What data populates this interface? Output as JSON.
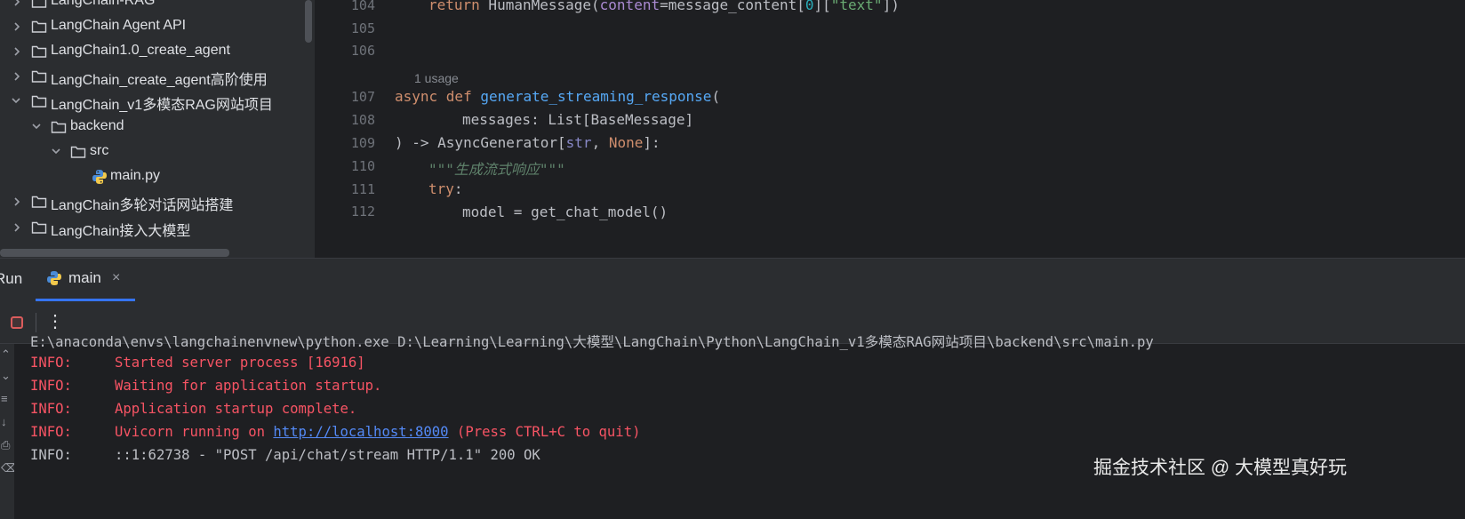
{
  "project_tree": {
    "items": [
      {
        "label": "LangChain-RAG",
        "expanded": false
      },
      {
        "label": "LangChain Agent API",
        "expanded": false
      },
      {
        "label": "LangChain1.0_create_agent",
        "expanded": false
      },
      {
        "label": "LangChain_create_agent高阶使用",
        "expanded": false
      },
      {
        "label": "LangChain_v1多模态RAG网站项目",
        "expanded": true
      },
      {
        "label": "backend",
        "expanded": true
      },
      {
        "label": "src",
        "expanded": true
      },
      {
        "label": "main.py",
        "type": "python-file"
      },
      {
        "label": "LangChain多轮对话网站搭建",
        "expanded": false
      },
      {
        "label": "LangChain接入大模型",
        "expanded": false
      }
    ]
  },
  "editor": {
    "line_numbers": [
      "104",
      "105",
      "106",
      "107",
      "108",
      "109",
      "110",
      "111",
      "112"
    ],
    "usage_hint": "1 usage",
    "code": {
      "l104": {
        "kw": "return",
        "call": " HumanMessage(",
        "param": "content",
        "eq": "=message_content[",
        "idx": "0",
        "mid": "][",
        "str": "\"text\"",
        "end": "])"
      },
      "l107": {
        "kw": "async def",
        "fn": "generate_streaming_response",
        "end": "("
      },
      "l108": {
        "text": "messages: List[BaseMessage]"
      },
      "l109": {
        "a": ") -> AsyncGenerator[",
        "builtin": "str",
        "comma": ", ",
        "none": "None",
        "end": "]:"
      },
      "l110": {
        "doc": "\"\"\"生成流式响应\"\"\""
      },
      "l111": {
        "kw": "try",
        "end": ":"
      },
      "l112": {
        "text": "model = get_chat_model()"
      }
    }
  },
  "run_window": {
    "title": "Run",
    "tab_label": "main",
    "close_symbol": "×",
    "more_symbol": "⋮"
  },
  "console": {
    "command": "E:\\anaconda\\envs\\langchainenvnew\\python.exe D:\\Learning\\Learning\\大模型\\LangChain\\Python\\LangChain_v1多模态RAG网站项目\\backend\\src\\main.py",
    "lines": [
      {
        "level": "INFO:",
        "message": "Started server process [16916]"
      },
      {
        "level": "INFO:",
        "message": "Waiting for application startup."
      },
      {
        "level": "INFO:",
        "message": "Application startup complete."
      }
    ],
    "uvicorn": {
      "level": "INFO:",
      "prefix": "Uvicorn running on ",
      "link": "http://localhost:8000",
      "suffix": " (Press CTRL+C to quit)"
    },
    "request": {
      "level": "INFO:",
      "message": "::1:62738 - \"POST /api/chat/stream HTTP/1.1\" 200 OK"
    }
  },
  "watermark": "掘金技术社区 @ 大模型真好玩",
  "colors": {
    "accent": "#3574f0",
    "error": "#f75464",
    "link": "#548af7",
    "stop": "#db5c5c"
  }
}
